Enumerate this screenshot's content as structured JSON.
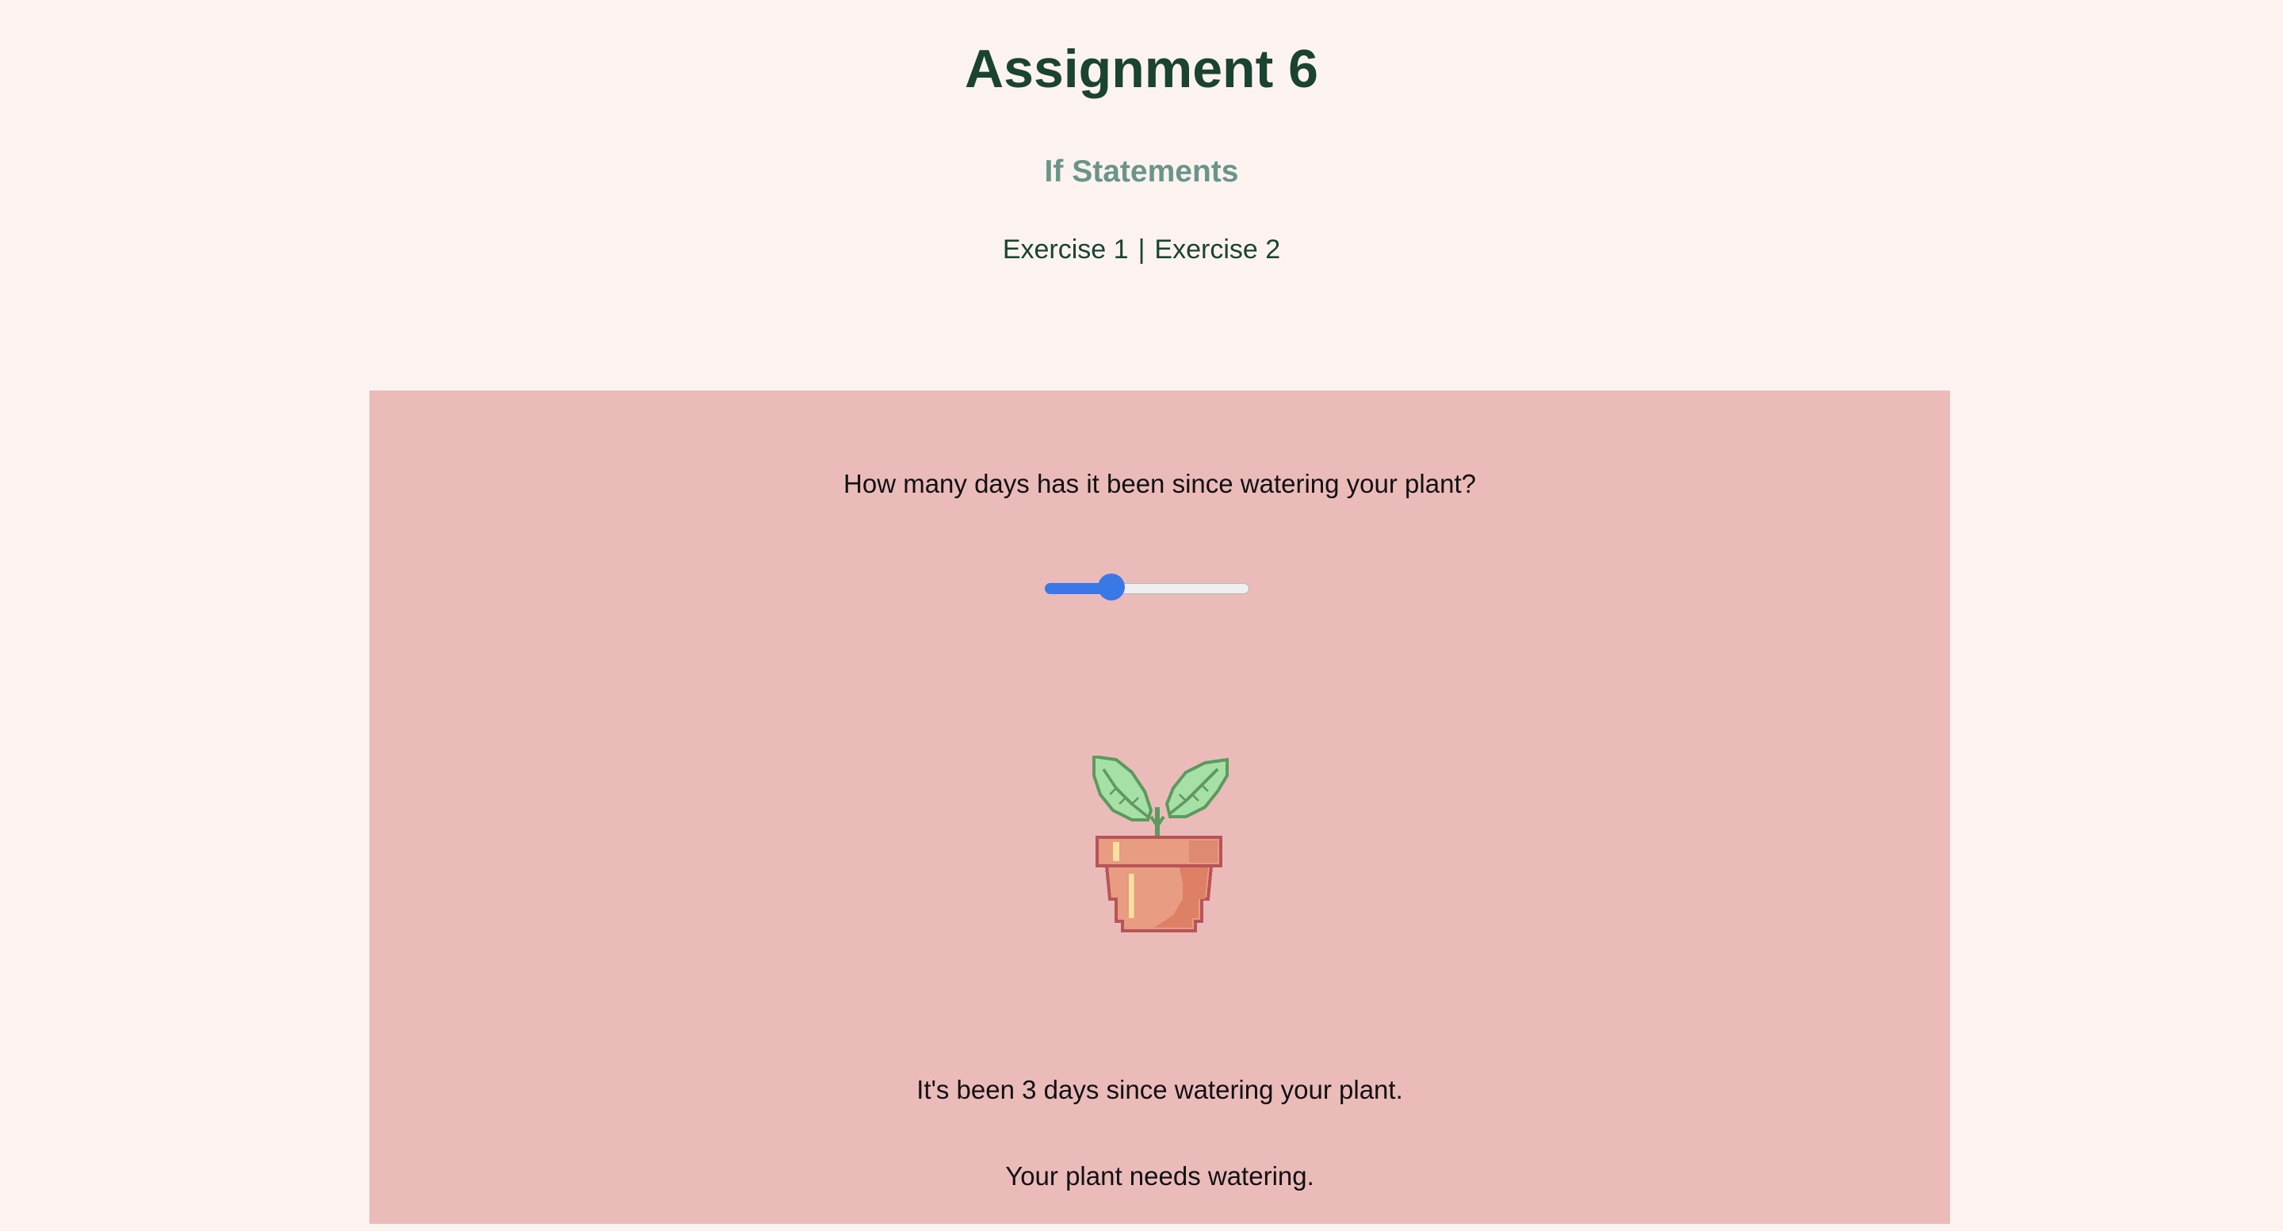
{
  "header": {
    "title": "Assignment 6",
    "subtitle": "If Statements",
    "nav": [
      {
        "label": "Exercise 1"
      },
      {
        "label": "Exercise 2"
      }
    ],
    "separator": "|"
  },
  "exercise": {
    "question": "How many days has it been since watering your plant?",
    "slider": {
      "value": 3,
      "min": 0,
      "max": 10
    },
    "plant_icon": "potted-plant-icon",
    "days_message": "It's been 3 days since watering your plant.",
    "advice_message": "Your plant needs watering."
  },
  "colors": {
    "background": "#fcf3f0",
    "panel": "#ebbbba",
    "title": "#1a4330",
    "subtitle": "#6a9588",
    "slider_accent": "#3b78e7"
  }
}
